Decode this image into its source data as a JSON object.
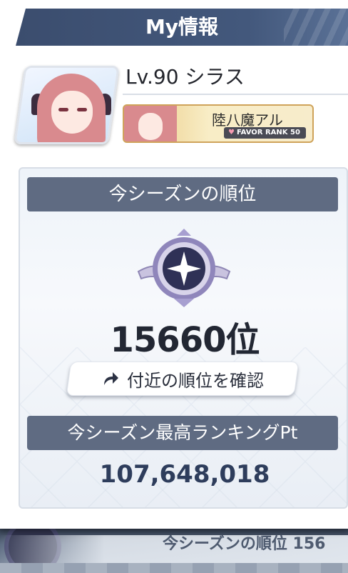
{
  "header": {
    "title": "My情報"
  },
  "player": {
    "level_name": "Lv.90 シラス"
  },
  "favor": {
    "student_name": "陸八魔アル",
    "rank_label": "FAVOR RANK 50"
  },
  "ranking": {
    "season_rank_heading": "今シーズンの順位",
    "season_rank_value": "15660位",
    "nearby_button_label": "付近の順位を確認",
    "best_points_heading": "今シーズン最高ランキングPt",
    "best_points_value": "107,648,018"
  },
  "underlay": {
    "text": "今シーズンの順位 156"
  },
  "colors": {
    "header": "#43587c",
    "band": "#5f6b82",
    "favor_gold": "#e9c57a"
  },
  "icons": [
    "avatar-portrait",
    "favor-portrait",
    "heart-icon",
    "medal-icon",
    "share-arrow-icon"
  ]
}
